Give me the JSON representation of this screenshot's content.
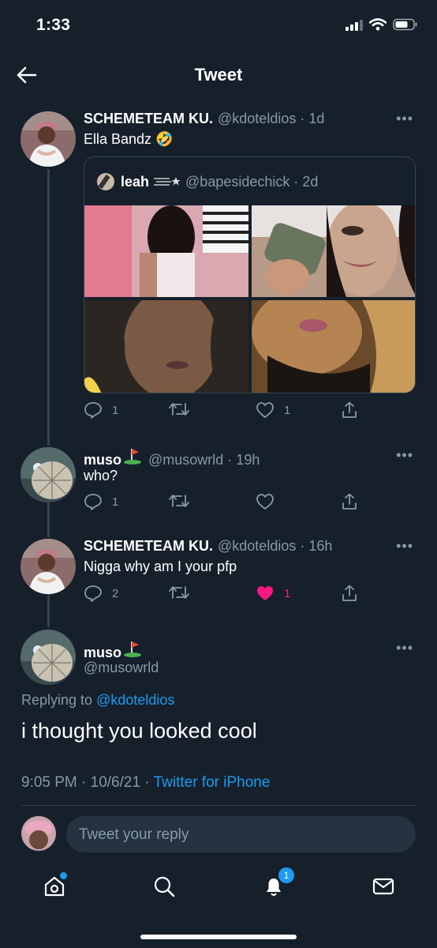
{
  "status_bar": {
    "time": "1:33"
  },
  "nav": {
    "title": "Tweet"
  },
  "tweets": [
    {
      "display_name": "SCHEMETEAM KU.",
      "handle": "@kdoteldios · 1d",
      "text": "Ella Bandz 🤣",
      "quote": {
        "display_name": "leah",
        "handle": "@bapesidechick · 2d"
      },
      "actions": {
        "replies": "1",
        "retweets": "",
        "likes": "1"
      }
    },
    {
      "display_name": "muso",
      "handle": "@musowrld · 19h",
      "text": "who?",
      "actions": {
        "replies": "1",
        "retweets": "",
        "likes": ""
      }
    },
    {
      "display_name": "SCHEMETEAM KU.",
      "handle": "@kdoteldios · 16h",
      "text": "Nigga why am I your pfp",
      "actions": {
        "replies": "2",
        "retweets": "",
        "likes": "1"
      },
      "liked": true
    }
  ],
  "main_tweet": {
    "display_name": "muso",
    "handle": "@musowrld",
    "replying_prefix": "Replying to",
    "replying_to": "@kdoteldios",
    "text": "i thought you looked cool",
    "timestamp": "9:05 PM · 10/6/21 · ",
    "source": "Twitter for iPhone"
  },
  "reply_bar": {
    "placeholder": "Tweet your reply"
  },
  "tab_bar": {
    "notifications_badge": "1"
  },
  "colors": {
    "background": "#15202b",
    "accent": "#1d9bf0",
    "like": "#f91880",
    "muted": "#8899a6",
    "divider": "#38444d"
  },
  "icons": [
    "back-arrow-icon",
    "more-icon",
    "reply-icon",
    "retweet-icon",
    "like-icon",
    "share-icon",
    "home-icon",
    "search-icon",
    "notifications-icon",
    "messages-icon",
    "golf-flag-icon",
    "rolling-laugh-emoji"
  ]
}
